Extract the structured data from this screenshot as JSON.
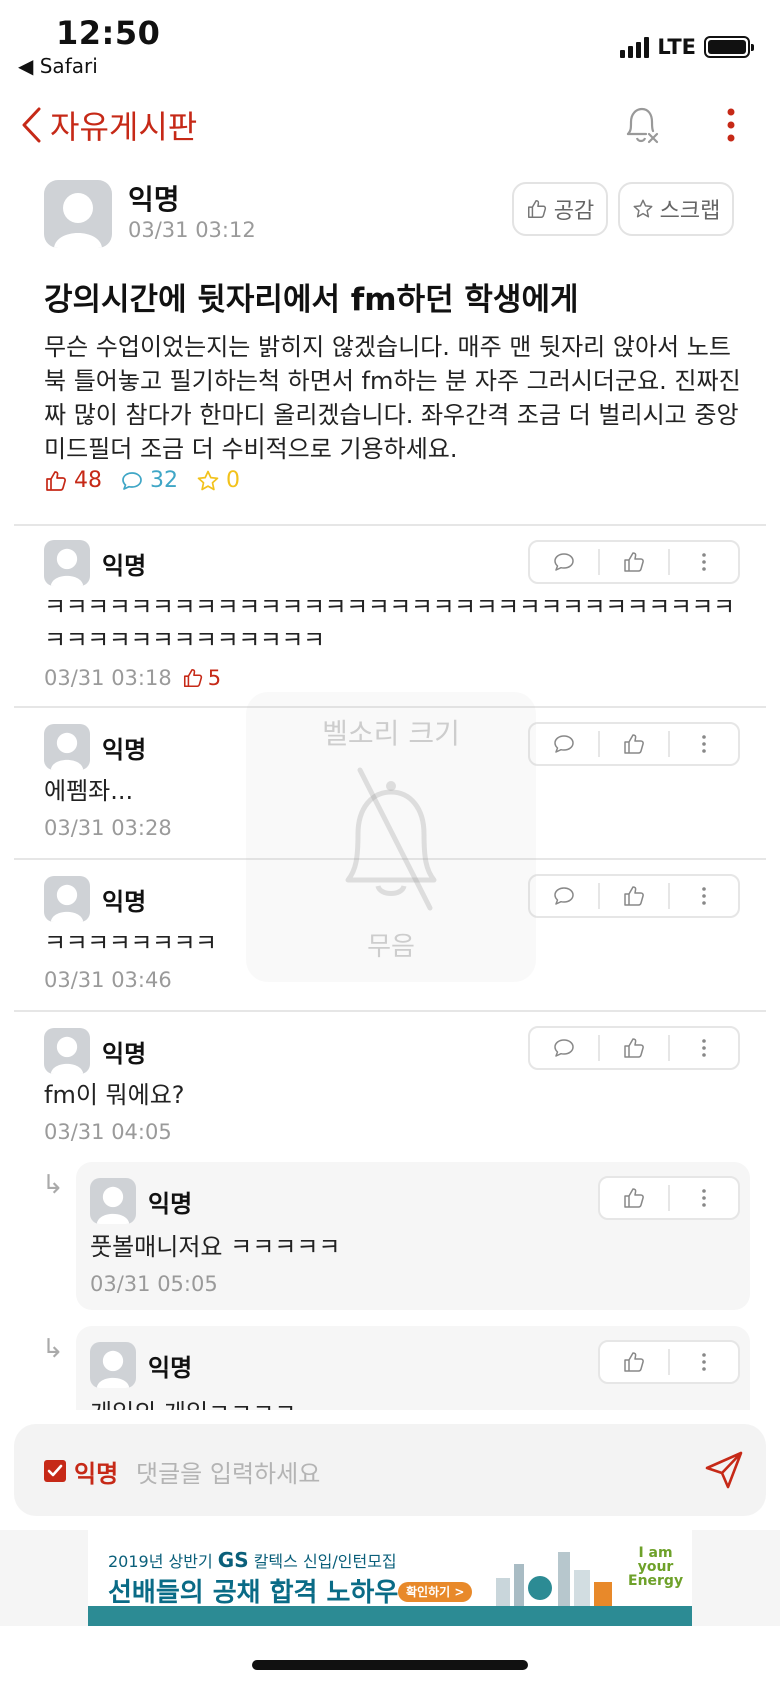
{
  "status": {
    "time": "12:50",
    "back_app": "◀ Safari",
    "network": "LTE"
  },
  "nav": {
    "title": "자유게시판"
  },
  "post": {
    "author": "익명",
    "date": "03/31 03:12",
    "like_button": "공감",
    "scrap_button": "스크랩",
    "title": "강의시간에 뒷자리에서 fm하던 학생에게",
    "body": "무슨 수업이었는지는 밝히지 않겠습니다. 매주 맨 뒷자리 앉아서 노트북 틀어놓고 필기하는척 하면서 fm하는 분 자주 그러시더군요. 진짜진짜 많이 참다가 한마디 올리겠습니다. 좌우간격 조금 더 벌리시고 중앙 미드필더 조금 더 수비적으로 기용하세요.",
    "likes": "48",
    "comments": "32",
    "scraps": "0",
    "colors": {
      "like": "#c62917",
      "comment": "#3fa6c6",
      "scrap": "#f2c21b"
    }
  },
  "comments": [
    {
      "author": "익명",
      "text_1": "ㅋㅋㅋㅋㅋㅋㅋㅋㅋㅋㅋㅋㅋㅋㅋㅋㅋㅋㅋㅋㅋㅋㅋㅋㅋㅋㅋㅋㅋㅋㅋㅋ",
      "text_2": "ㅋㅋㅋㅋㅋㅋㅋㅋㅋㅋㅋㅋㅋ",
      "date": "03/31 03:18",
      "likes": "5"
    },
    {
      "author": "익명",
      "text": "에펨좌...",
      "date": "03/31 03:28"
    },
    {
      "author": "익명",
      "text": "ㅋㅋㅋㅋㅋㅋㅋㅋ",
      "date": "03/31 03:46"
    },
    {
      "author": "익명",
      "text": "fm이 뭐에요?",
      "date": "03/31 04:05"
    }
  ],
  "replies": [
    {
      "author": "익명",
      "text": "풋볼매니저요 ㅋㅋㅋㅋㅋ",
      "date": "03/31 05:05"
    },
    {
      "author": "익명",
      "text": "게임의 게임ㅋㅋㅋㅋ"
    }
  ],
  "ringer": {
    "title": "벨소리 크기",
    "state": "무음"
  },
  "input": {
    "anon_label": "익명",
    "placeholder": "댓글을 입력하세요"
  },
  "ad": {
    "line1_prefix": "2019년 상반기 ",
    "line1_brand": "GS",
    "line1_suffix": " 칼텍스 신입/인턴모집",
    "line2": "선배들의 공채 합격 노하우",
    "button": "확인하기 >",
    "slogan_1": "I am",
    "slogan_2": "your",
    "slogan_3": "Energy"
  }
}
